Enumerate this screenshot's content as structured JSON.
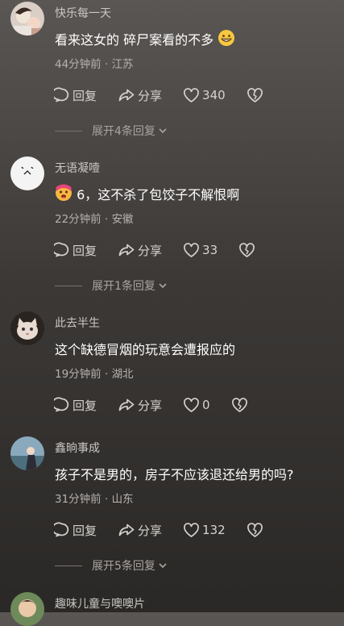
{
  "icons": {
    "reply": "chat-bubble-icon",
    "share": "share-arrow-icon",
    "like": "heart-icon",
    "dislike": "broken-heart-icon",
    "expand": "chevron-down-icon"
  },
  "comments": [
    {
      "username": "快乐每一天",
      "text": "看来这女的 碎尸案看的不多",
      "emoji_after": "grinning-face",
      "time": "44分钟前",
      "location": "江苏",
      "reply_label": "回复",
      "share_label": "分享",
      "likes": "340",
      "expand_label": "展开4条回复"
    },
    {
      "username": "无语凝噎",
      "emoji_before": "hot-face",
      "text": "6，这不杀了包饺子不解恨啊",
      "time": "22分钟前",
      "location": "安徽",
      "reply_label": "回复",
      "share_label": "分享",
      "likes": "33",
      "expand_label": "展开1条回复"
    },
    {
      "username": "此去半生",
      "text": "这个缺德冒烟的玩意会遭报应的",
      "time": "19分钟前",
      "location": "湖北",
      "reply_label": "回复",
      "share_label": "分享",
      "likes": "0"
    },
    {
      "username": "鑫晌事成",
      "text": "孩子不是男的，房子不应该退还给男的吗?",
      "time": "31分钟前",
      "location": "山东",
      "reply_label": "回复",
      "share_label": "分享",
      "likes": "132",
      "expand_label": "展开5条回复"
    },
    {
      "username": "趣味儿童与噢噢片"
    }
  ],
  "separator": " · "
}
